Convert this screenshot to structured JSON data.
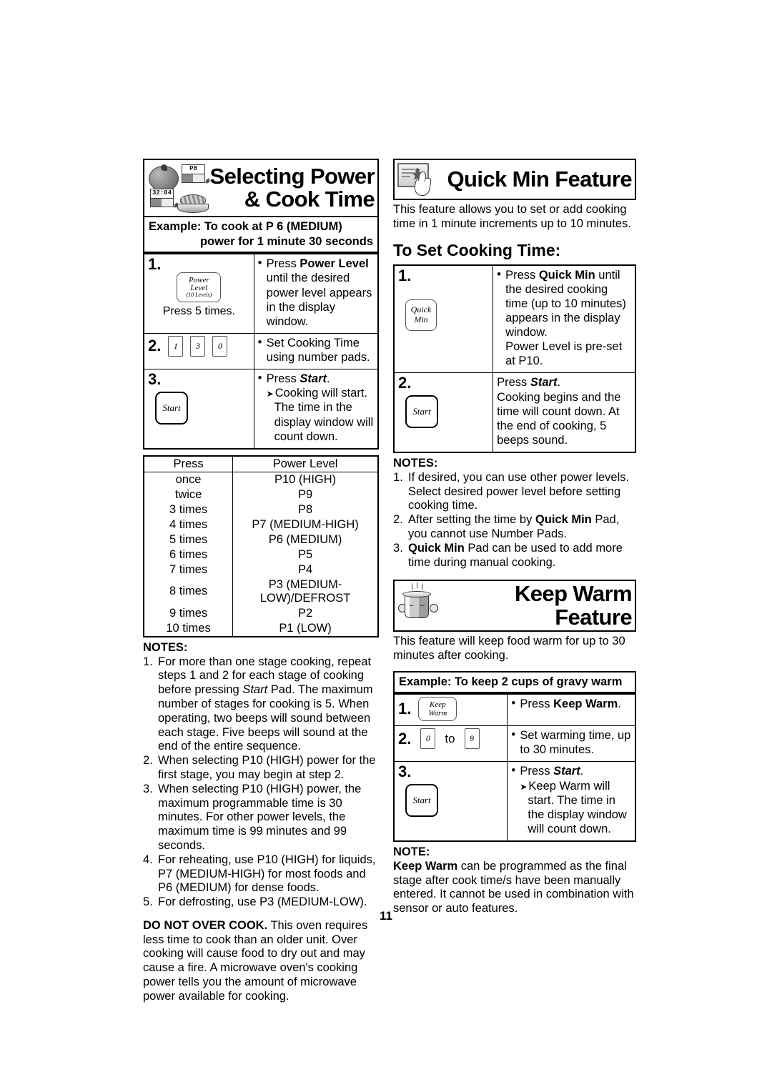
{
  "page": {
    "number": "11"
  },
  "left": {
    "banner": {
      "line1": "Selecting Power",
      "line2": "& Cook Time",
      "display_value": "P8",
      "display_value2": "32:04"
    },
    "example": {
      "line1": "Example: To cook at P 6 (MEDIUM)",
      "line2": "power for 1 minute 30 seconds"
    },
    "steps": [
      {
        "num": "1.",
        "pad_label_line1": "Power",
        "pad_label_line2": "Level",
        "pad_label_line3": "(10 Levels)",
        "pad_caption": "Press 5 times.",
        "text_prefix": "Press ",
        "text_bold": "Power Level",
        "text_rest": " until the desired power level appears in the display window."
      },
      {
        "num": "2.",
        "keys": [
          "1",
          "3",
          "0"
        ],
        "text": "Set Cooking Time using number pads."
      },
      {
        "num": "3.",
        "pad_label": "Start",
        "text_prefix": "Press ",
        "text_bold_italic": "Start",
        "text_rest": ".",
        "sub_text": "Cooking will start. The time in the display window will count down."
      }
    ],
    "power_table": {
      "headers": [
        "Press",
        "Power Level"
      ],
      "rows": [
        [
          "once",
          "P10 (HIGH)"
        ],
        [
          "twice",
          "P9"
        ],
        [
          "3 times",
          "P8"
        ],
        [
          "4 times",
          "P7 (MEDIUM-HIGH)"
        ],
        [
          "5 times",
          "P6 (MEDIUM)"
        ],
        [
          "6 times",
          "P5"
        ],
        [
          "7 times",
          "P4"
        ],
        [
          "8 times",
          "P3 (MEDIUM-LOW)/DEFROST"
        ],
        [
          "9 times",
          "P2"
        ],
        [
          "10 times",
          "P1 (LOW)"
        ]
      ]
    },
    "notes_heading": "NOTES:",
    "notes": [
      {
        "pre": "For more than one stage cooking, repeat steps 1 and 2 for each stage of cooking before pressing ",
        "bold_italic": "Start",
        "post": " Pad. The maximum number of stages for cooking is 5. When operating, two beeps will sound between each stage. Five beeps will sound at the end of the entire sequence."
      },
      {
        "pre": "When selecting P10 (HIGH) power for the first stage, you may begin at step 2."
      },
      {
        "pre": "When selecting P10 (HIGH) power, the maximum programmable time is 30 minutes. For other power levels, the maximum time is 99 minutes and 99 seconds."
      },
      {
        "pre": "For reheating, use P10 (HIGH) for liquids, P7 (MEDIUM-HIGH) for most foods and P6 (MEDIUM) for dense foods."
      },
      {
        "pre": "For defrosting, use P3 (MEDIUM-LOW)."
      }
    ],
    "warning": {
      "bold": "DO NOT OVER COOK.",
      "rest": " This oven requires less time to cook than an older unit. Over cooking will cause food to dry out and may cause a fire. A microwave oven's cooking power tells you the amount of microwave power available for cooking."
    }
  },
  "right": {
    "quick_min": {
      "banner_title": "Quick Min Feature",
      "intro": "This feature allows you to set or add cooking time in 1 minute increments up to 10 minutes.",
      "subhead": "To Set Cooking Time:",
      "steps": [
        {
          "num": "1.",
          "pad_label_line1": "Quick",
          "pad_label_line2": "Min",
          "text_prefix": "Press ",
          "text_bold": "Quick Min",
          "text_rest": " until the desired cooking time (up to 10 minutes) appears in the display window.",
          "text_extra": "Power Level is pre-set at P10."
        },
        {
          "num": "2.",
          "pad_label": "Start",
          "text_prefix": "Press ",
          "text_bold_italic": "Start",
          "text_rest": ".",
          "text_extra": "Cooking begins and the time will count down. At the end of cooking, 5 beeps sound."
        }
      ],
      "notes_heading": "NOTES:",
      "notes": [
        {
          "pre": "If desired, you can use other power levels. Select desired power level before setting cooking time."
        },
        {
          "pre": "After setting the time by ",
          "bold": "Quick Min",
          "post": " Pad, you cannot use Number Pads."
        },
        {
          "pre": "",
          "bold": "Quick Min",
          "post": " Pad can be used to add more time during manual cooking."
        }
      ]
    },
    "keep_warm": {
      "banner_title": "Keep Warm Feature",
      "intro": "This feature will keep food warm for up to 30 minutes after cooking.",
      "example": "Example: To keep 2 cups of gravy warm",
      "steps": [
        {
          "num": "1.",
          "pad_label_line1": "Keep",
          "pad_label_line2": "Warm",
          "text_prefix": "Press ",
          "text_bold": "Keep Warm",
          "text_rest": "."
        },
        {
          "num": "2.",
          "key_from": "0",
          "key_join": "to",
          "key_to": "9",
          "text": "Set warming time, up to 30 minutes."
        },
        {
          "num": "3.",
          "pad_label": "Start",
          "text_prefix": "Press ",
          "text_bold_italic": "Start",
          "text_rest": ".",
          "sub_text": "Keep Warm will start. The time in the display window will count down."
        }
      ],
      "note_heading": "NOTE:",
      "note": {
        "bold": "Keep Warm",
        "rest": " can be programmed as the final stage after cook time/s have been manually entered. It cannot be used in combination with sensor or auto features."
      }
    }
  }
}
